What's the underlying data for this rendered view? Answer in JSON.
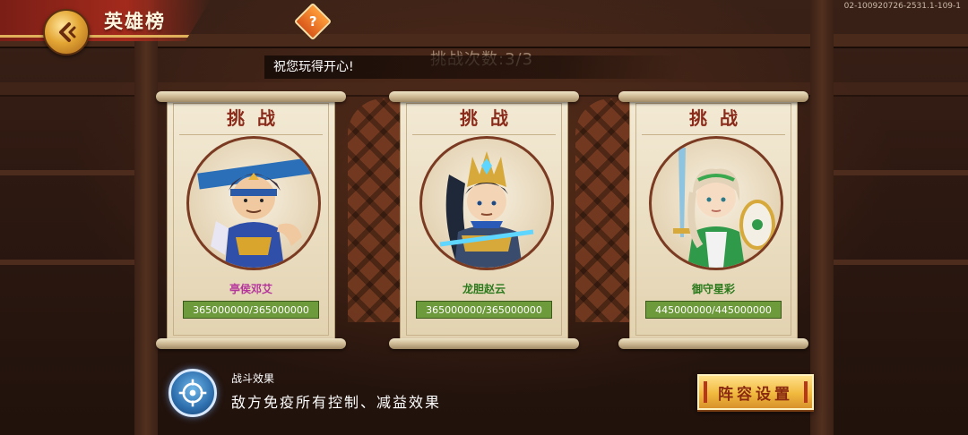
{
  "header": {
    "title": "英雄榜",
    "help_label": "?",
    "build_id": "02-100920726-2531.1-109-1"
  },
  "challenge_count": "挑战次数:3/3",
  "toast": "祝您玩得开心!",
  "cards": [
    {
      "title": "挑战",
      "name": "亭侯邓艾",
      "name_color": "#b5349c",
      "hp_text": "365000000/365000000",
      "hp_fraction": 1.0
    },
    {
      "title": "挑战",
      "name": "龙胆赵云",
      "name_color": "#2a7a1c",
      "hp_text": "365000000/365000000",
      "hp_fraction": 1.0
    },
    {
      "title": "挑战",
      "name": "御守星彩",
      "name_color": "#2a7a1c",
      "hp_text": "445000000/445000000",
      "hp_fraction": 1.0
    }
  ],
  "effect": {
    "title": "战斗效果",
    "description": "敌方免疫所有控制、减益效果",
    "icon": "target-icon"
  },
  "lineup_button": "阵容设置",
  "colors": {
    "accent": "#f1b93e",
    "banner": "#a32a1c",
    "hp_green": "#5f8a33"
  }
}
